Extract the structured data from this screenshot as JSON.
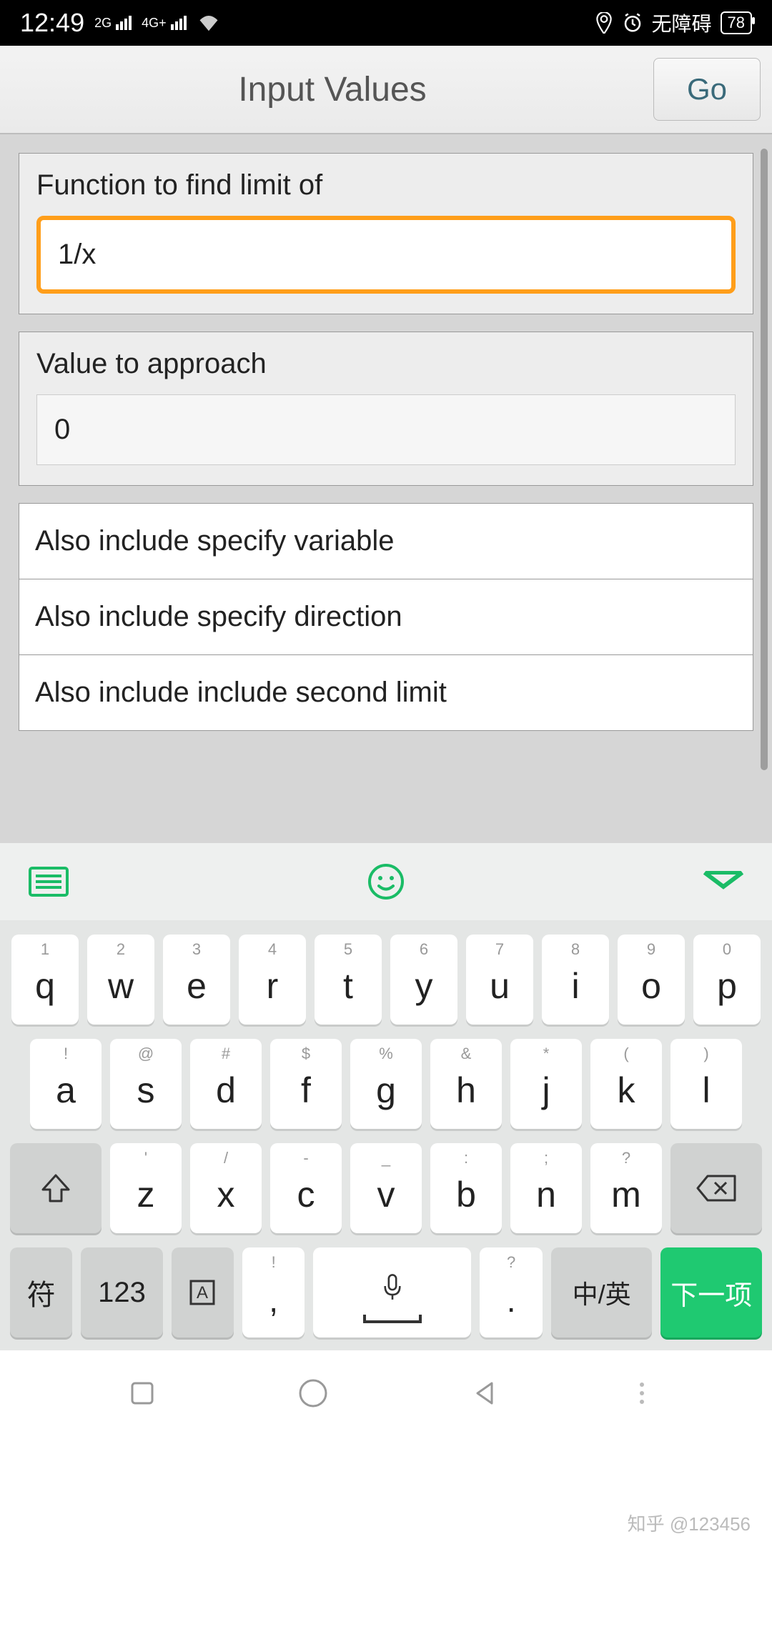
{
  "statusbar": {
    "time": "12:49",
    "net1": "2G",
    "net2": "4G+",
    "accessibility": "无障碍",
    "battery": "78"
  },
  "header": {
    "title": "Input Values",
    "go": "Go"
  },
  "form": {
    "function_label": "Function to find limit of",
    "function_value": "1/x",
    "value_label": "Value to approach",
    "value_value": "0",
    "options": [
      "Also include specify variable",
      "Also include specify direction",
      "Also include include second limit"
    ]
  },
  "keyboard": {
    "row1": [
      {
        "sup": "1",
        "main": "q"
      },
      {
        "sup": "2",
        "main": "w"
      },
      {
        "sup": "3",
        "main": "e"
      },
      {
        "sup": "4",
        "main": "r"
      },
      {
        "sup": "5",
        "main": "t"
      },
      {
        "sup": "6",
        "main": "y"
      },
      {
        "sup": "7",
        "main": "u"
      },
      {
        "sup": "8",
        "main": "i"
      },
      {
        "sup": "9",
        "main": "o"
      },
      {
        "sup": "0",
        "main": "p"
      }
    ],
    "row2": [
      {
        "sup": "!",
        "main": "a"
      },
      {
        "sup": "@",
        "main": "s"
      },
      {
        "sup": "#",
        "main": "d"
      },
      {
        "sup": "$",
        "main": "f"
      },
      {
        "sup": "%",
        "main": "g"
      },
      {
        "sup": "&",
        "main": "h"
      },
      {
        "sup": "*",
        "main": "j"
      },
      {
        "sup": "(",
        "main": "k"
      },
      {
        "sup": ")",
        "main": "l"
      }
    ],
    "row3": [
      {
        "sup": "'",
        "main": "z"
      },
      {
        "sup": "/",
        "main": "x"
      },
      {
        "sup": "-",
        "main": "c"
      },
      {
        "sup": "_",
        "main": "v"
      },
      {
        "sup": ":",
        "main": "b"
      },
      {
        "sup": ";",
        "main": "n"
      },
      {
        "sup": "?",
        "main": "m"
      }
    ],
    "row4": {
      "sym": "符",
      "num": "123",
      "comma_sup": "!",
      "comma": ",",
      "period_sup": "?",
      "period": ".",
      "lang": "中/英",
      "enter": "下一项"
    }
  },
  "watermark": "知乎 @123456"
}
